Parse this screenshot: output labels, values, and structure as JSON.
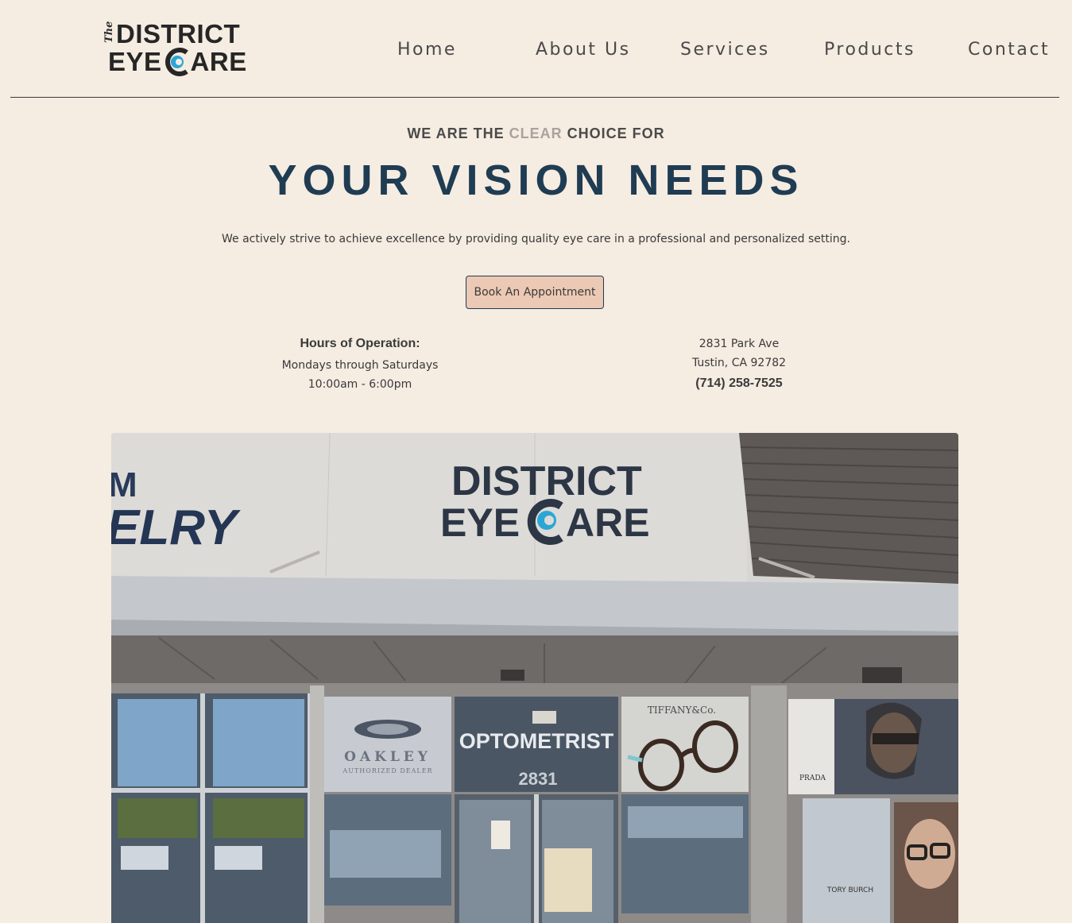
{
  "logo": {
    "the": "The",
    "line1": "DISTRICT",
    "line2_left": "EYE",
    "line2_right": "ARE"
  },
  "nav": {
    "items": [
      {
        "label": "Home"
      },
      {
        "label": "About Us"
      },
      {
        "label": "Services"
      },
      {
        "label": "Products"
      },
      {
        "label": "Contact"
      }
    ]
  },
  "hero": {
    "kicker_before": "WE ARE THE ",
    "kicker_highlight": "CLEAR",
    "kicker_after": " CHOICE FOR",
    "headline": "YOUR VISION NEEDS",
    "tagline": "We actively strive to achieve excellence by providing quality eye care in a professional and personalized setting.",
    "cta_label": "Book An Appointment"
  },
  "hours": {
    "title": "Hours of Operation:",
    "days": "Mondays through Saturdays",
    "times": "10:00am - 6:00pm"
  },
  "address": {
    "street": "2831 Park Ave",
    "city": "Tustin, CA 92782",
    "phone": "(714) 258-7525"
  },
  "storefront": {
    "sign_line1": "DISTRICT",
    "sign_line2_left": "EYE",
    "sign_line2_right": "ARE",
    "neighbor_sign_top": "M",
    "neighbor_sign_bottom": "ELRY",
    "window_optometrist": "OPTOMETRIST",
    "window_number": "2831",
    "oakley_brand": "OAKLEY",
    "oakley_sub": "AUTHORIZED DEALER",
    "tiffany_brand": "TIFFANY&Co.",
    "prada_brand": "PRADA",
    "tory_brand": "TORY BURCH",
    "colors": {
      "brand_navy": "#1f3c52",
      "brand_cyan": "#2aa7d6",
      "wall": "#d8d6d2",
      "siding": "#5e5957"
    }
  },
  "colors": {
    "background": "#f5ece2",
    "headline": "#1f3c52",
    "button_bg": "#ecc9b4",
    "highlight_gray": "#a8a39d"
  }
}
